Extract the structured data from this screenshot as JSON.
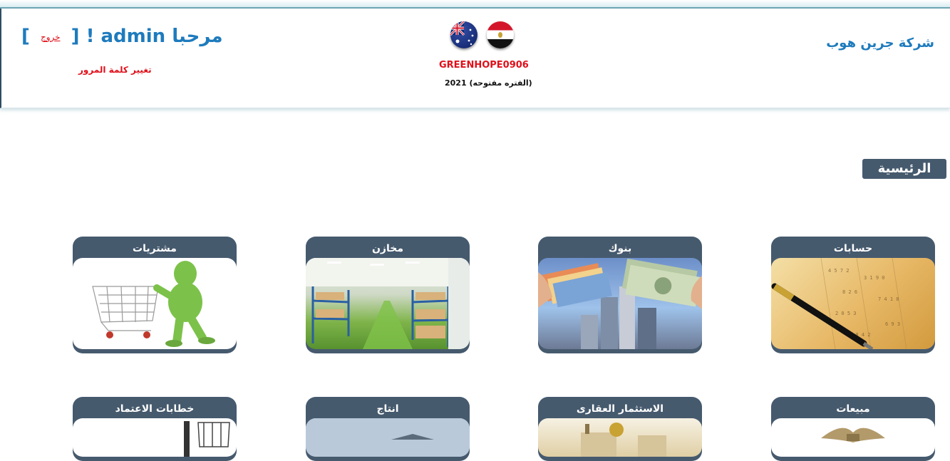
{
  "header": {
    "greeting_prefix": "مرحبا",
    "username": "admin",
    "exclamation": "!",
    "bracket_open": "[",
    "logout_label": "خروج",
    "bracket_close": "]",
    "change_password_label": "تغيير كلمة المرور",
    "company_code": "GREENHOPE0906",
    "period": "2021 (الفتره مفتوحه)",
    "company_name": "شركة جرين هوب",
    "flags": [
      "australia-flag-icon",
      "egypt-flag-icon"
    ]
  },
  "home_tab": "الرئيسية",
  "tiles": [
    {
      "label": "حسابات",
      "image": "pen-ledger-icon"
    },
    {
      "label": "بنوك",
      "image": "money-buildings-icon"
    },
    {
      "label": "مخازن",
      "image": "warehouse-icon"
    },
    {
      "label": "مشتريات",
      "image": "shopping-cart-icon"
    },
    {
      "label": "مبيعات",
      "image": "money-bag-icon"
    },
    {
      "label": "الاستثمار العقارى",
      "image": "real-estate-icon"
    },
    {
      "label": "انتاج",
      "image": "factory-icon"
    },
    {
      "label": "خطابات الاعتماد",
      "image": "forklift-icon"
    }
  ],
  "colors": {
    "accent_blue": "#1e7bbd",
    "alert_red": "#e0101a",
    "tile_header": "#465a6e"
  }
}
